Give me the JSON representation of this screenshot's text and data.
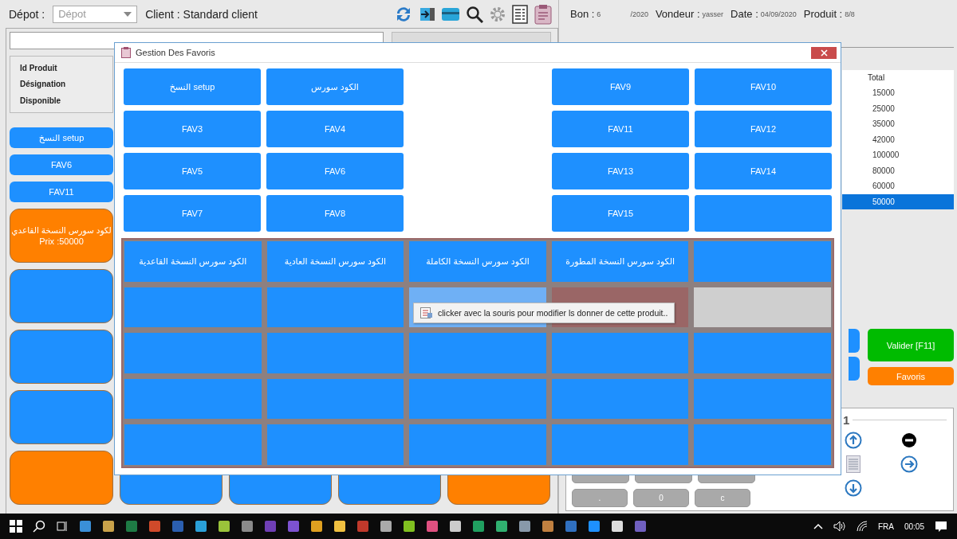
{
  "top_bar": {
    "depot_label": "Dépot  :",
    "depot_select": {
      "placeholder": "Dépot"
    },
    "client_label": "Client  : Standard client"
  },
  "product_info": {
    "labels": [
      "Id Produit",
      "Désignation",
      "Disponible"
    ]
  },
  "sidebar_favorites": [
    "النسخ setup",
    "FAV6",
    "FAV11"
  ],
  "product_cards": [
    {
      "color": "#ff8000",
      "title": "لكود سورس النسخة القاعدي",
      "price": "Prix :50000"
    },
    {
      "color": "#1e90ff"
    },
    {
      "color": "#1e90ff"
    },
    {
      "color": "#1e90ff"
    },
    {
      "color": "#ff8000"
    }
  ],
  "bottom_cards": [
    {
      "color": "#1e90ff"
    },
    {
      "color": "#1e90ff"
    },
    {
      "color": "#1e90ff"
    },
    {
      "color": "#ff8000"
    }
  ],
  "header": {
    "bon_label": "Bon :",
    "bon_value": "6",
    "bon_year": "/2020",
    "vendeur_label": "Vondeur :",
    "vendeur_value": "yasser",
    "date_label": "Date :",
    "date_value": "04/09/2020",
    "produit_label": "Produit :",
    "produit_value": "8/8"
  },
  "table": {
    "column": "Total",
    "rows": [
      {
        "value": "15000",
        "selected": false
      },
      {
        "value": "25000",
        "selected": false
      },
      {
        "value": "35000",
        "selected": false
      },
      {
        "value": "42000",
        "selected": false
      },
      {
        "value": "100000",
        "selected": false
      },
      {
        "value": "80000",
        "selected": false
      },
      {
        "value": "60000",
        "selected": false
      },
      {
        "value": "50000",
        "selected": true
      }
    ]
  },
  "actions": [
    {
      "label": "Valider [F11]",
      "color": "#00bb00"
    },
    {
      "label": "Favoris",
      "color": "#ff8000"
    }
  ],
  "quantity": "1",
  "keypad": [
    ".",
    "0",
    "c"
  ],
  "dialog": {
    "title": "Gestion Des Favoris",
    "favorites": [
      {
        "kind": "fav",
        "label": "النسخ setup"
      },
      {
        "kind": "fav",
        "label": "الكود سورس"
      },
      {
        "kind": "empty"
      },
      {
        "kind": "fav",
        "label": "FAV9"
      },
      {
        "kind": "fav",
        "label": "FAV10"
      },
      {
        "kind": "fav",
        "label": "FAV3"
      },
      {
        "kind": "fav",
        "label": "FAV4"
      },
      {
        "kind": "empty"
      },
      {
        "kind": "fav",
        "label": "FAV11"
      },
      {
        "kind": "fav",
        "label": "FAV12"
      },
      {
        "kind": "fav",
        "label": "FAV5"
      },
      {
        "kind": "fav",
        "label": "FAV6"
      },
      {
        "kind": "empty"
      },
      {
        "kind": "fav",
        "label": "FAV13"
      },
      {
        "kind": "fav",
        "label": "FAV14"
      },
      {
        "kind": "fav",
        "label": "FAV7"
      },
      {
        "kind": "fav",
        "label": "FAV8"
      },
      {
        "kind": "empty"
      },
      {
        "kind": "fav",
        "label": "FAV15"
      },
      {
        "kind": "fav"
      }
    ],
    "products": [
      {
        "kind": "product"
      },
      {
        "kind": "product",
        "label": "الكود سورس النسخة المطورة"
      },
      {
        "kind": "product",
        "label": "الكود سورس النسخة الكاملة"
      },
      {
        "kind": "product",
        "label": "الكود سورس النسخة العادية"
      },
      {
        "kind": "product",
        "label": "الكود سورس النسخة القاعدية"
      },
      {
        "kind": "grey"
      },
      {
        "kind": "none"
      },
      {
        "kind": "hover"
      },
      {
        "kind": "product"
      },
      {
        "kind": "product"
      },
      {
        "kind": "product"
      },
      {
        "kind": "product"
      },
      {
        "kind": "product"
      },
      {
        "kind": "product"
      },
      {
        "kind": "product"
      },
      {
        "kind": "product"
      },
      {
        "kind": "product"
      },
      {
        "kind": "product"
      },
      {
        "kind": "product"
      },
      {
        "kind": "product"
      },
      {
        "kind": "product"
      },
      {
        "kind": "product"
      },
      {
        "kind": "product"
      },
      {
        "kind": "product"
      },
      {
        "kind": "product"
      }
    ],
    "tooltip": "clicker avec la souris pour modifier ls donner de cette produit.."
  },
  "taskbar": {
    "language": "FRA",
    "time": "00:05"
  }
}
